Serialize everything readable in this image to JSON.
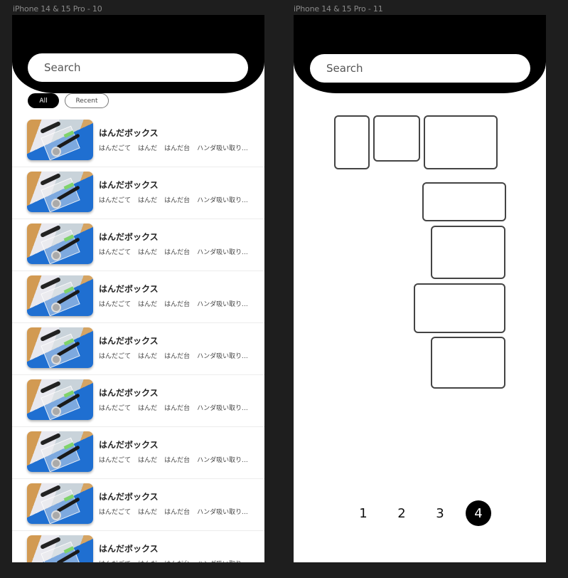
{
  "frames": [
    {
      "label": "iPhone 14 & 15 Pro - 10",
      "search_placeholder": "Search",
      "filters": [
        {
          "label": "All",
          "active": true
        },
        {
          "label": "Recent",
          "active": false
        }
      ],
      "items": [
        {
          "title": "はんだボックス",
          "tags": [
            "はんだごて",
            "はんだ",
            "はんだ台",
            "ハンダ吸い取り..."
          ]
        },
        {
          "title": "はんだボックス",
          "tags": [
            "はんだごて",
            "はんだ",
            "はんだ台",
            "ハンダ吸い取り..."
          ]
        },
        {
          "title": "はんだボックス",
          "tags": [
            "はんだごて",
            "はんだ",
            "はんだ台",
            "ハンダ吸い取り..."
          ]
        },
        {
          "title": "はんだボックス",
          "tags": [
            "はんだごて",
            "はんだ",
            "はんだ台",
            "ハンダ吸い取り..."
          ]
        },
        {
          "title": "はんだボックス",
          "tags": [
            "はんだごて",
            "はんだ",
            "はんだ台",
            "ハンダ吸い取り..."
          ]
        },
        {
          "title": "はんだボックス",
          "tags": [
            "はんだごて",
            "はんだ",
            "はんだ台",
            "ハンダ吸い取り..."
          ]
        },
        {
          "title": "はんだボックス",
          "tags": [
            "はんだごて",
            "はんだ",
            "はんだ台",
            "ハンダ吸い取り..."
          ]
        },
        {
          "title": "はんだボックス",
          "tags": [
            "はんだごて",
            "はんだ",
            "はんだ台",
            "ハンダ吸い取り..."
          ]
        },
        {
          "title": "はんだボックス",
          "tags": [
            "はんだごて",
            "はんだ",
            "はんだ台",
            "ハンダ吸い取り..."
          ]
        }
      ]
    },
    {
      "label": "iPhone 14 & 15 Pro - 11",
      "search_placeholder": "Search",
      "pagination": {
        "pages": [
          "1",
          "2",
          "3",
          "4"
        ],
        "current": "4"
      }
    }
  ],
  "colors": {
    "canvas": "#1e1e1e",
    "header": "#000000",
    "accent": "#000000",
    "outline": "#444444"
  }
}
